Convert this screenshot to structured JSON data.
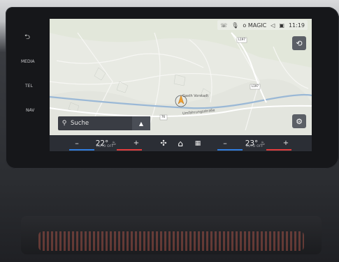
{
  "side_menu": {
    "back_icon": "back-arrow-icon",
    "items": [
      {
        "label": "MEDIA"
      },
      {
        "label": "TEL"
      },
      {
        "label": "NAV"
      }
    ]
  },
  "status_bar": {
    "connection_label": "o MAGIC",
    "time": "11:19"
  },
  "map": {
    "label_place": "Gasth Vorstadt",
    "label_street": "Umfahrungsstraße",
    "road_badges": [
      "L197",
      "L197",
      "76"
    ]
  },
  "search": {
    "placeholder": "Suche"
  },
  "climate": {
    "left": {
      "minus": "–",
      "temp": "22°",
      "auto": "AUTO OFF",
      "plus": "+"
    },
    "right": {
      "minus": "–",
      "temp": "23°",
      "auto": "AUTO OFF",
      "plus": "+"
    }
  },
  "colors": {
    "cool": "#2f7de0",
    "warm": "#e23b3b",
    "route": "#5d8fc4",
    "position": "#f0a030"
  }
}
